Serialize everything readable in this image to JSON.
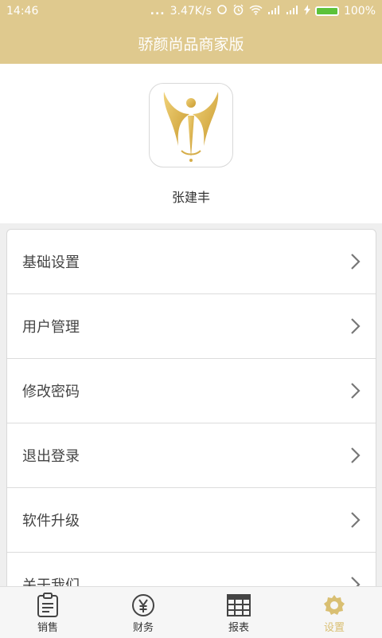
{
  "status": {
    "time": "14:46",
    "dots": "...",
    "speed": "3.47K/s",
    "battery": "100%",
    "colors": {
      "bar": "#dfc98e",
      "battery_fill": "#5cc23a"
    }
  },
  "header": {
    "title": "骄颜尚品商家版"
  },
  "profile": {
    "name": "张建丰",
    "logo_icon": "golden-figure-logo-icon"
  },
  "menu": {
    "items": [
      {
        "label": "基础设置"
      },
      {
        "label": "用户管理"
      },
      {
        "label": "修改密码"
      },
      {
        "label": "退出登录"
      },
      {
        "label": "软件升级"
      },
      {
        "label": "关于我们"
      }
    ]
  },
  "tabs": [
    {
      "label": "销售",
      "icon": "clipboard-icon"
    },
    {
      "label": "财务",
      "icon": "yen-icon"
    },
    {
      "label": "报表",
      "icon": "grid-table-icon"
    },
    {
      "label": "设置",
      "icon": "gear-icon",
      "active": true
    }
  ],
  "accent": "#d9bf72"
}
